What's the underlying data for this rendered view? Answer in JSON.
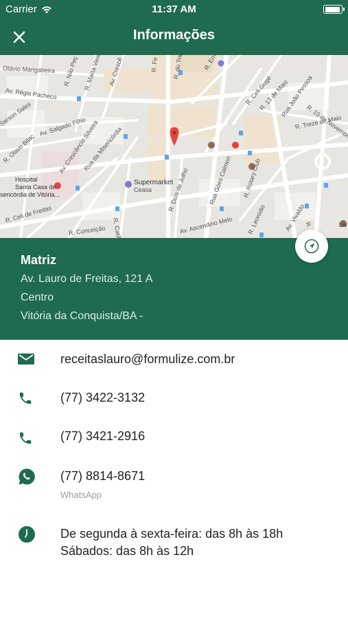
{
  "status_bar": {
    "carrier": "Carrier",
    "time": "11:37 AM",
    "battery_level": 0.95
  },
  "navbar": {
    "title": "Informações",
    "close_icon": "close-icon"
  },
  "map": {
    "labels": {
      "otavio": "Otávio Mangabeira",
      "regis": "Av. Régis Pacheco",
      "salgado": "Av. Salgado Filho",
      "sales": "Sarson Sales",
      "olavo": "R. Olavo Bilac",
      "crescencio": "Av. Crescêncio Silveira",
      "misericordia": "Rua da Misericórdia",
      "hospital1": "Hospital",
      "hospital2": "Santa Casa de",
      "hospital3": "sericórdia de Vitória...",
      "celi_freitas": "R. Celi de Freitas",
      "conceicao": "R. Conceição",
      "catao": "R. Catão Ferraz",
      "supermarket": "Supermarket",
      "ceasa": "Ceasa",
      "dois_julho": "R. Dois de Julho",
      "goes_calmon": "Rua Góes Calmon",
      "rotary": "R. Rotary Club",
      "ascendino": "Av. Ascendino Melo",
      "leonidio": "R. Leonídio",
      "vivaldo": "Av. Vivaldo",
      "treze_maio": "R. Treze de Maio",
      "joao_pessoa": "Rua João Pessoa",
      "dez_nov": "R. 10 de Novembro",
      "treze_maio2": "R. 13 de Maio",
      "celi_gugel": "R. Celi Gugé",
      "nilo": "R. Nilo Peç",
      "marta": "R. Marta Vasc",
      "crescencio2": "Av. Crescê",
      "triun": "R. do Triun",
      "ernes": "R. Ernes",
      "fe": "R. Fe",
      "s": "R. S",
      "liv": "Liv"
    }
  },
  "location": {
    "name": "Matriz",
    "street": "Av. Lauro de Freitas, 121 A",
    "district": "Centro",
    "city": "Vitória da Conquista/BA -"
  },
  "contacts": {
    "email": "receitaslauro@formulize.com.br",
    "phone1": "(77) 3422-3132",
    "phone2": "(77) 3421-2916",
    "whatsapp": "(77) 8814-8671",
    "whatsapp_label": "WhatsApp",
    "hours_weekdays": "De segunda à sexta-feira: das 8h às 18h",
    "hours_saturday": "Sábados: das 8h às 12h"
  },
  "colors": {
    "brand_green": "#1f6b4f",
    "icon_green": "#1f6b4f"
  }
}
